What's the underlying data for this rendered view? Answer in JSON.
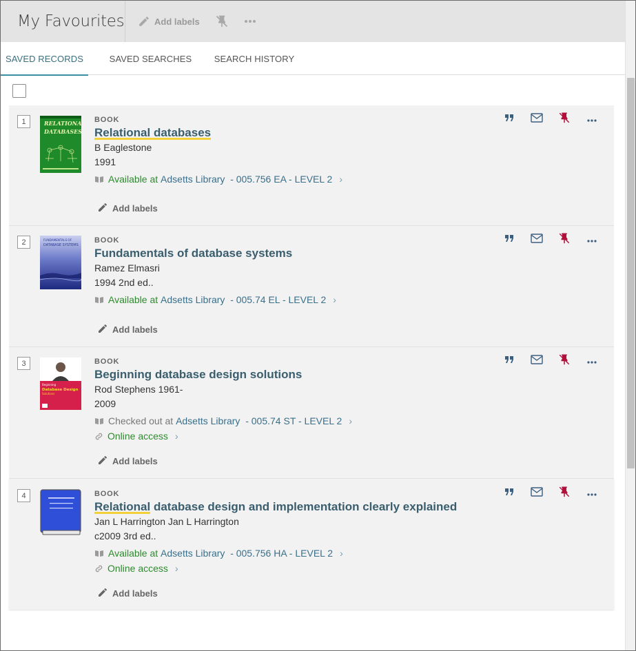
{
  "header": {
    "title": "My Favourites",
    "add_labels": "Add labels"
  },
  "tabs": [
    {
      "label": "SAVED RECORDS"
    },
    {
      "label": "SAVED SEARCHES"
    },
    {
      "label": "SEARCH HISTORY"
    }
  ],
  "records": [
    {
      "num": "1",
      "type": "BOOK",
      "title_hl": "Relational databases",
      "title_rest": "",
      "author": "B Eaglestone",
      "date": "1991",
      "availability": {
        "status": "Available at",
        "library": "Adsetts Library",
        "location": "- 005.756 EA - LEVEL 2"
      },
      "online": "",
      "add_labels": "Add labels",
      "cover": {
        "title": "RELATIONAL DATABASES",
        "color": "#1f8a2a"
      }
    },
    {
      "num": "2",
      "type": "BOOK",
      "title_hl": "",
      "title_rest": "Fundamentals of database systems",
      "author": "Ramez Elmasri",
      "date": "1994 2nd ed..",
      "availability": {
        "status": "Available at",
        "library": "Adsetts Library",
        "location": "- 005.74 EL - LEVEL 2"
      },
      "online": "",
      "add_labels": "Add labels",
      "cover": {
        "title": "FUNDAMENTALS OF DATABASE SYSTEMS",
        "color": "#3a4aa8"
      }
    },
    {
      "num": "3",
      "type": "BOOK",
      "title_hl": "",
      "title_rest": "Beginning database design solutions",
      "author": "Rod Stephens 1961-",
      "date": "2009",
      "availability": {
        "status": "Checked out at",
        "library": "Adsetts Library",
        "location": "- 005.74 ST - LEVEL 2"
      },
      "online": "Online access",
      "add_labels": "Add labels",
      "cover": {
        "title": "Database Design Solutions",
        "color": "#d4204a"
      }
    },
    {
      "num": "4",
      "type": "BOOK",
      "title_hl": "Relational",
      "title_rest": " database design and implementation clearly explained",
      "author": "Jan L Harrington Jan L Harrington",
      "date": "c2009 3rd ed..",
      "availability": {
        "status": "Available at",
        "library": "Adsetts Library",
        "location": "- 005.756 HA - LEVEL 2"
      },
      "online": "Online access",
      "add_labels": "Add labels",
      "cover": {
        "title": "",
        "color": "#2f4fd8"
      }
    }
  ],
  "colors": {
    "accent": "#3a8fa3",
    "available": "#2d8a2d",
    "unpin": "#b0103a",
    "highlight": "#f3cf3a"
  }
}
